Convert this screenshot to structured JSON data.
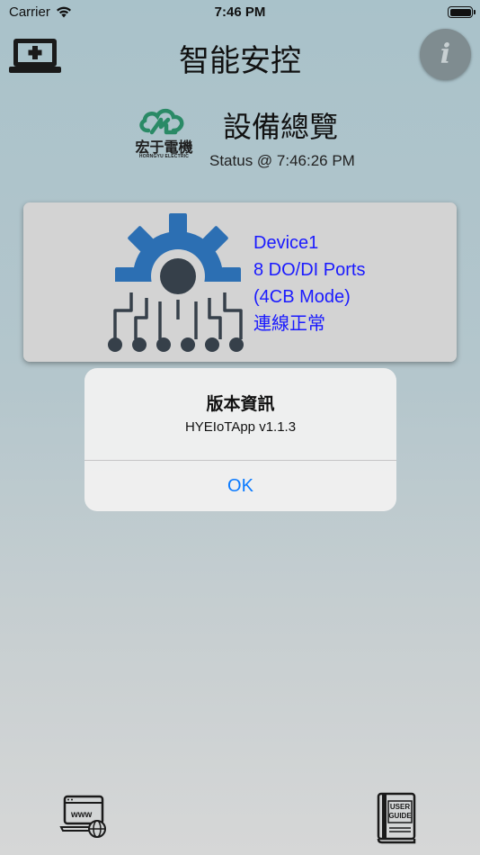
{
  "status_bar": {
    "carrier": "Carrier",
    "time": "7:46 PM",
    "wifi_icon": "wifi-icon",
    "battery_icon": "battery-icon"
  },
  "nav": {
    "title": "智能安控",
    "left_icon": "add-device-icon",
    "info_label": "i"
  },
  "header": {
    "logo_text": "宏于電機",
    "logo_subtext": "HORNGYU ELECTRIC",
    "title": "設備總覽",
    "status": "Status @ 7:46:26 PM"
  },
  "device": {
    "icon": "gear-circuit-icon",
    "name": "Device1",
    "ports": "8 DO/DI Ports",
    "mode": "(4CB Mode)",
    "connection": "連線正常"
  },
  "alert": {
    "title": "版本資訊",
    "message": "HYEIoTApp v1.1.3",
    "ok_label": "OK"
  },
  "bottom": {
    "www_label": "www",
    "guide_label_1": "USER",
    "guide_label_2": "GUIDE"
  },
  "colors": {
    "device_text": "#1a1aff",
    "alert_button": "#0a7aff",
    "gear_blue": "#2c6fb3",
    "gear_dark": "#36404a",
    "logo_green": "#2a8a66"
  }
}
